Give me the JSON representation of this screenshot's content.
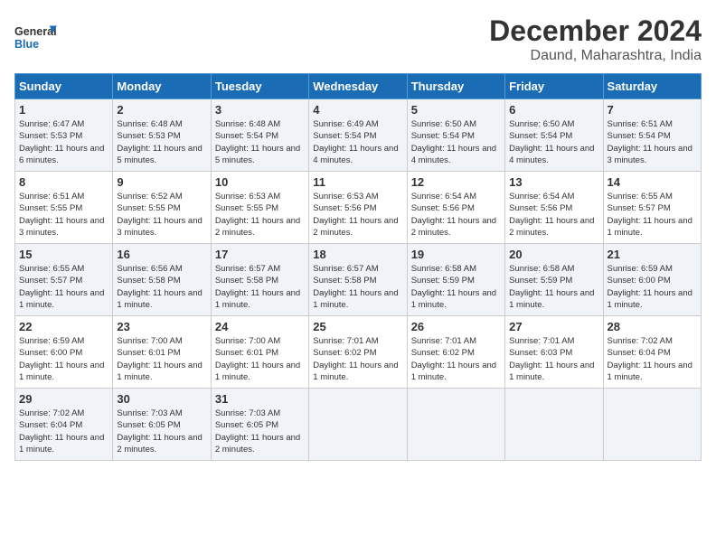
{
  "logo": {
    "line1": "General",
    "line2": "Blue"
  },
  "title": "December 2024",
  "subtitle": "Daund, Maharashtra, India",
  "days_of_week": [
    "Sunday",
    "Monday",
    "Tuesday",
    "Wednesday",
    "Thursday",
    "Friday",
    "Saturday"
  ],
  "weeks": [
    [
      {
        "day": 1,
        "sunrise": "6:47 AM",
        "sunset": "5:53 PM",
        "daylight": "11 hours and 6 minutes."
      },
      {
        "day": 2,
        "sunrise": "6:48 AM",
        "sunset": "5:53 PM",
        "daylight": "11 hours and 5 minutes."
      },
      {
        "day": 3,
        "sunrise": "6:48 AM",
        "sunset": "5:54 PM",
        "daylight": "11 hours and 5 minutes."
      },
      {
        "day": 4,
        "sunrise": "6:49 AM",
        "sunset": "5:54 PM",
        "daylight": "11 hours and 4 minutes."
      },
      {
        "day": 5,
        "sunrise": "6:50 AM",
        "sunset": "5:54 PM",
        "daylight": "11 hours and 4 minutes."
      },
      {
        "day": 6,
        "sunrise": "6:50 AM",
        "sunset": "5:54 PM",
        "daylight": "11 hours and 4 minutes."
      },
      {
        "day": 7,
        "sunrise": "6:51 AM",
        "sunset": "5:54 PM",
        "daylight": "11 hours and 3 minutes."
      }
    ],
    [
      {
        "day": 8,
        "sunrise": "6:51 AM",
        "sunset": "5:55 PM",
        "daylight": "11 hours and 3 minutes."
      },
      {
        "day": 9,
        "sunrise": "6:52 AM",
        "sunset": "5:55 PM",
        "daylight": "11 hours and 3 minutes."
      },
      {
        "day": 10,
        "sunrise": "6:53 AM",
        "sunset": "5:55 PM",
        "daylight": "11 hours and 2 minutes."
      },
      {
        "day": 11,
        "sunrise": "6:53 AM",
        "sunset": "5:56 PM",
        "daylight": "11 hours and 2 minutes."
      },
      {
        "day": 12,
        "sunrise": "6:54 AM",
        "sunset": "5:56 PM",
        "daylight": "11 hours and 2 minutes."
      },
      {
        "day": 13,
        "sunrise": "6:54 AM",
        "sunset": "5:56 PM",
        "daylight": "11 hours and 2 minutes."
      },
      {
        "day": 14,
        "sunrise": "6:55 AM",
        "sunset": "5:57 PM",
        "daylight": "11 hours and 1 minute."
      }
    ],
    [
      {
        "day": 15,
        "sunrise": "6:55 AM",
        "sunset": "5:57 PM",
        "daylight": "11 hours and 1 minute."
      },
      {
        "day": 16,
        "sunrise": "6:56 AM",
        "sunset": "5:58 PM",
        "daylight": "11 hours and 1 minute."
      },
      {
        "day": 17,
        "sunrise": "6:57 AM",
        "sunset": "5:58 PM",
        "daylight": "11 hours and 1 minute."
      },
      {
        "day": 18,
        "sunrise": "6:57 AM",
        "sunset": "5:58 PM",
        "daylight": "11 hours and 1 minute."
      },
      {
        "day": 19,
        "sunrise": "6:58 AM",
        "sunset": "5:59 PM",
        "daylight": "11 hours and 1 minute."
      },
      {
        "day": 20,
        "sunrise": "6:58 AM",
        "sunset": "5:59 PM",
        "daylight": "11 hours and 1 minute."
      },
      {
        "day": 21,
        "sunrise": "6:59 AM",
        "sunset": "6:00 PM",
        "daylight": "11 hours and 1 minute."
      }
    ],
    [
      {
        "day": 22,
        "sunrise": "6:59 AM",
        "sunset": "6:00 PM",
        "daylight": "11 hours and 1 minute."
      },
      {
        "day": 23,
        "sunrise": "7:00 AM",
        "sunset": "6:01 PM",
        "daylight": "11 hours and 1 minute."
      },
      {
        "day": 24,
        "sunrise": "7:00 AM",
        "sunset": "6:01 PM",
        "daylight": "11 hours and 1 minute."
      },
      {
        "day": 25,
        "sunrise": "7:01 AM",
        "sunset": "6:02 PM",
        "daylight": "11 hours and 1 minute."
      },
      {
        "day": 26,
        "sunrise": "7:01 AM",
        "sunset": "6:02 PM",
        "daylight": "11 hours and 1 minute."
      },
      {
        "day": 27,
        "sunrise": "7:01 AM",
        "sunset": "6:03 PM",
        "daylight": "11 hours and 1 minute."
      },
      {
        "day": 28,
        "sunrise": "7:02 AM",
        "sunset": "6:04 PM",
        "daylight": "11 hours and 1 minute."
      }
    ],
    [
      {
        "day": 29,
        "sunrise": "7:02 AM",
        "sunset": "6:04 PM",
        "daylight": "11 hours and 1 minute."
      },
      {
        "day": 30,
        "sunrise": "7:03 AM",
        "sunset": "6:05 PM",
        "daylight": "11 hours and 2 minutes."
      },
      {
        "day": 31,
        "sunrise": "7:03 AM",
        "sunset": "6:05 PM",
        "daylight": "11 hours and 2 minutes."
      },
      null,
      null,
      null,
      null
    ]
  ]
}
